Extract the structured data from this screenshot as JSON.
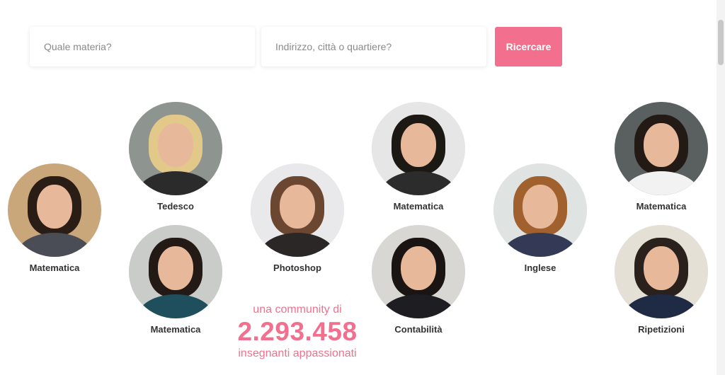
{
  "search": {
    "subject_placeholder": "Quale materia?",
    "location_placeholder": "Indirizzo, città o quartiere?",
    "button_label": "Ricercare",
    "button_color": "#f2708e"
  },
  "teachers": [
    {
      "subject": "Matematica",
      "photo": "teacher-photo",
      "bg": "#c9a77b",
      "hair": "#2a1d16",
      "body": "#4a4d55"
    },
    {
      "subject": "Tedesco",
      "photo": "teacher-photo",
      "bg": "#8e9490",
      "hair": "#e2c98a",
      "body": "#2b2b2b"
    },
    {
      "subject": "Matematica",
      "photo": "teacher-photo",
      "bg": "#c9ccc9",
      "hair": "#241a15",
      "body": "#1f4f5c"
    },
    {
      "subject": "Photoshop",
      "photo": "teacher-photo",
      "bg": "#e9e9eb",
      "hair": "#6b4631",
      "body": "#2b2726"
    },
    {
      "subject": "Matematica",
      "photo": "teacher-photo",
      "bg": "#e6e6e6",
      "hair": "#1c1915",
      "body": "#2c2c2c"
    },
    {
      "subject": "Contabilità",
      "photo": "teacher-photo",
      "bg": "#d9d7d3",
      "hair": "#1a1512",
      "body": "#1d1d22"
    },
    {
      "subject": "Inglese",
      "photo": "teacher-photo",
      "bg": "#dfe3e1",
      "hair": "#a0612e",
      "body": "#343a55"
    },
    {
      "subject": "Matematica",
      "photo": "teacher-photo",
      "bg": "#59605f",
      "hair": "#241a15",
      "body": "#f2f2f2"
    },
    {
      "subject": "Ripetizioni",
      "photo": "teacher-photo",
      "bg": "#e5e0d6",
      "hair": "#2b211c",
      "body": "#1f2a44"
    }
  ],
  "community": {
    "line1": "una community di",
    "count": "2.293.458",
    "line3": "insegnanti appassionati"
  }
}
